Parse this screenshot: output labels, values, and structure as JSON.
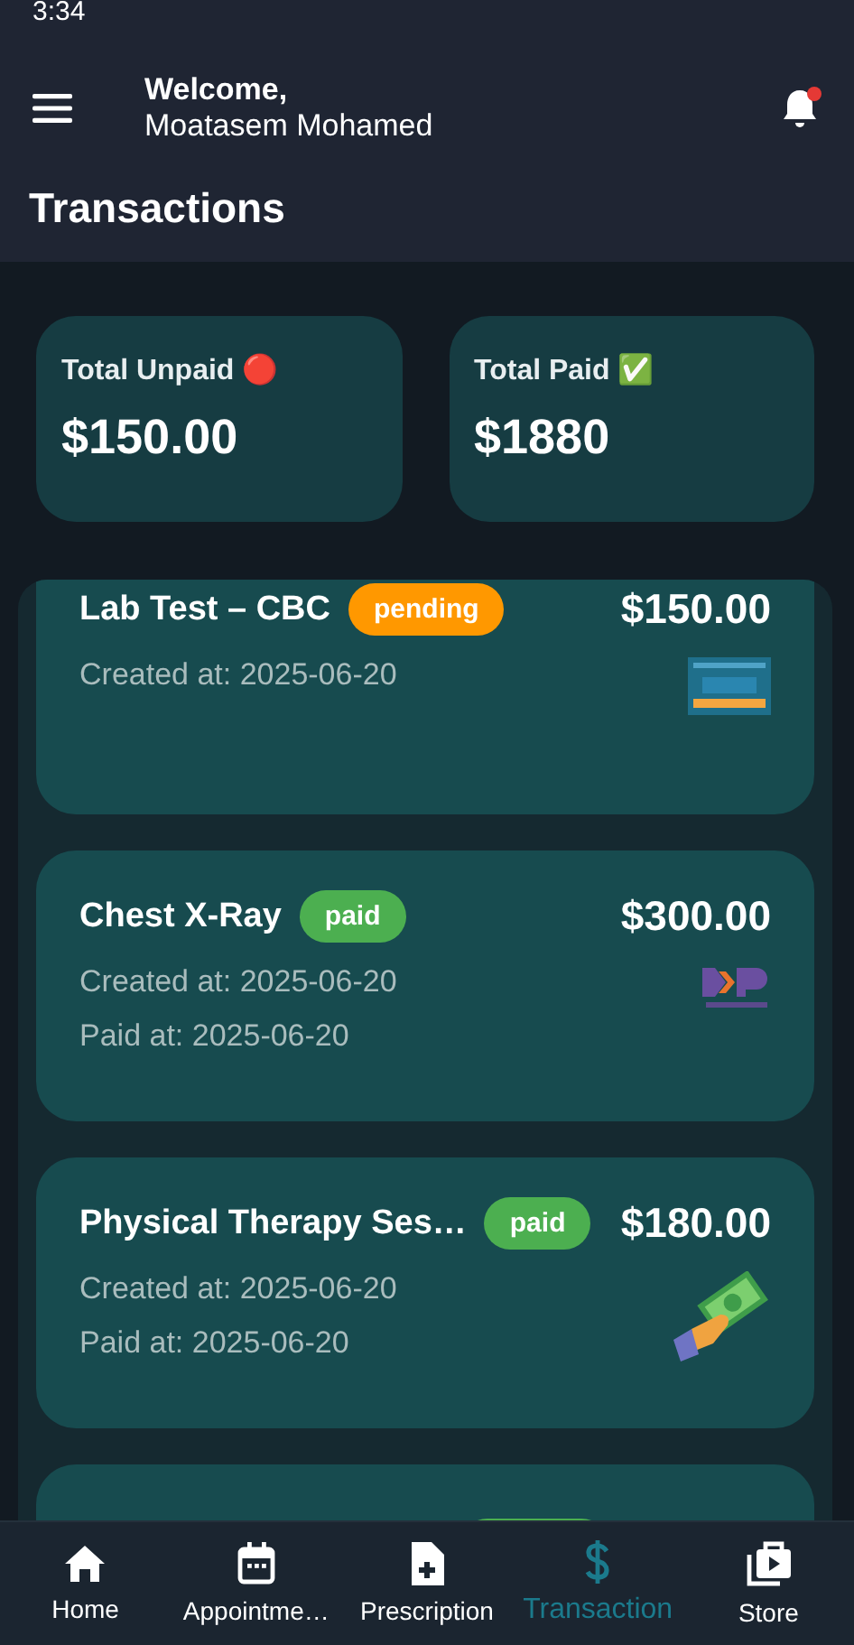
{
  "status_bar": {
    "time": "3:34"
  },
  "header": {
    "greeting": "Welcome,",
    "user": "Moatasem Mohamed",
    "notification": true
  },
  "title": "Transactions",
  "summary": [
    {
      "label": "Total Unpaid 🔴",
      "amount": "$150.00"
    },
    {
      "label": "Total Paid ✅",
      "amount": "$1880"
    }
  ],
  "transactions": [
    {
      "name": "Lab Test – CBC",
      "status": "pending",
      "color": "#ff9800",
      "amount": "$150.00",
      "created": "Created at: 2025-06-20",
      "kind": "visa"
    },
    {
      "name": "Chest X-Ray",
      "status": "paid",
      "color": "#4caf50",
      "amount": "$300.00",
      "created": "Created at: 2025-06-20",
      "paid": "Paid at: 2025-06-20",
      "kind": "wallet"
    },
    {
      "name": "Physical Therapy Ses…",
      "status": "paid",
      "color": "#4caf50",
      "amount": "$180.00",
      "created": "Created at: 2025-06-20",
      "paid": "Paid at: 2025-06-20",
      "kind": "cash"
    },
    {
      "kind": "cut",
      "color": "#4caf50"
    }
  ],
  "nav": [
    {
      "label": "Home",
      "selected": false
    },
    {
      "label": "Appointme…",
      "selected": false
    },
    {
      "label": "Prescription",
      "selected": false
    },
    {
      "label": "Transaction",
      "selected": true
    },
    {
      "label": "Store",
      "selected": false
    }
  ]
}
